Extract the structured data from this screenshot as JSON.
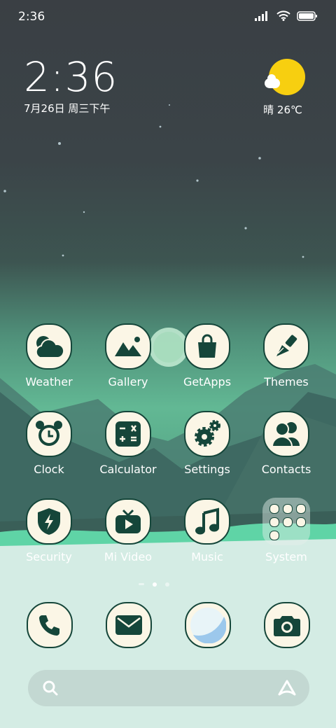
{
  "status_bar": {
    "time": "2:36"
  },
  "clock_widget": {
    "time": "2:36",
    "date": "7月26日 周三下午"
  },
  "weather_widget": {
    "condition_icon": "sun-cloud-icon",
    "text": "晴 26℃"
  },
  "apps": [
    {
      "label": "Weather",
      "icon": "weather-icon"
    },
    {
      "label": "Gallery",
      "icon": "gallery-icon"
    },
    {
      "label": "GetApps",
      "icon": "getapps-icon"
    },
    {
      "label": "Themes",
      "icon": "themes-icon"
    },
    {
      "label": "Clock",
      "icon": "clock-icon"
    },
    {
      "label": "Calculator",
      "icon": "calculator-icon"
    },
    {
      "label": "Settings",
      "icon": "settings-icon"
    },
    {
      "label": "Contacts",
      "icon": "contacts-icon"
    },
    {
      "label": "Security",
      "icon": "security-icon"
    },
    {
      "label": "Mi Video",
      "icon": "mi-video-icon"
    },
    {
      "label": "Music",
      "icon": "music-icon"
    },
    {
      "label": "System",
      "icon": "folder-icon"
    }
  ],
  "pager": {
    "pages": 3,
    "current": 2
  },
  "dock": [
    {
      "icon": "phone-icon"
    },
    {
      "icon": "messages-icon"
    },
    {
      "icon": "browser-icon"
    },
    {
      "icon": "camera-icon"
    }
  ],
  "colors": {
    "icon_bg": "#fbf6e6",
    "icon_fg": "#15463a",
    "sun": "#f7cf10"
  }
}
